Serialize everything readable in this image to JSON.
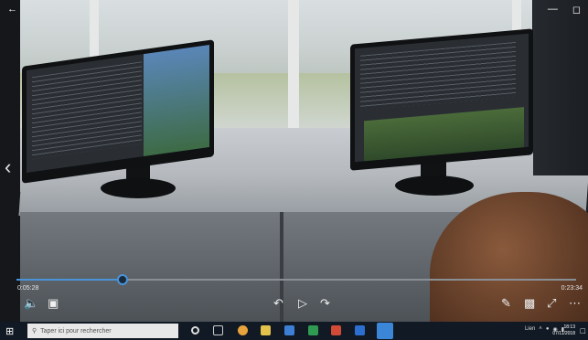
{
  "player": {
    "elapsed": "0:05:28",
    "duration": "0:23:34",
    "progress_fraction": 0.19
  },
  "taskbar": {
    "search_placeholder": "Taper ici pour rechercher",
    "language": "Lien",
    "clock_time": "18:13",
    "clock_date": "07/11/2018"
  },
  "colors": {
    "accent": "#4a93d9",
    "taskbar": "#111a24"
  },
  "icons": {
    "back": "arrow-left",
    "minimize": "minus",
    "restore": "square",
    "previous": "chevron-left",
    "volume": "speaker",
    "subtitles": "caption",
    "rewind": "rewind-10",
    "play": "play-triangle",
    "forward": "forward-30",
    "edit": "pencil",
    "miniview": "picture-in-picture",
    "fullscreen": "expand-arrows",
    "more": "ellipsis"
  }
}
